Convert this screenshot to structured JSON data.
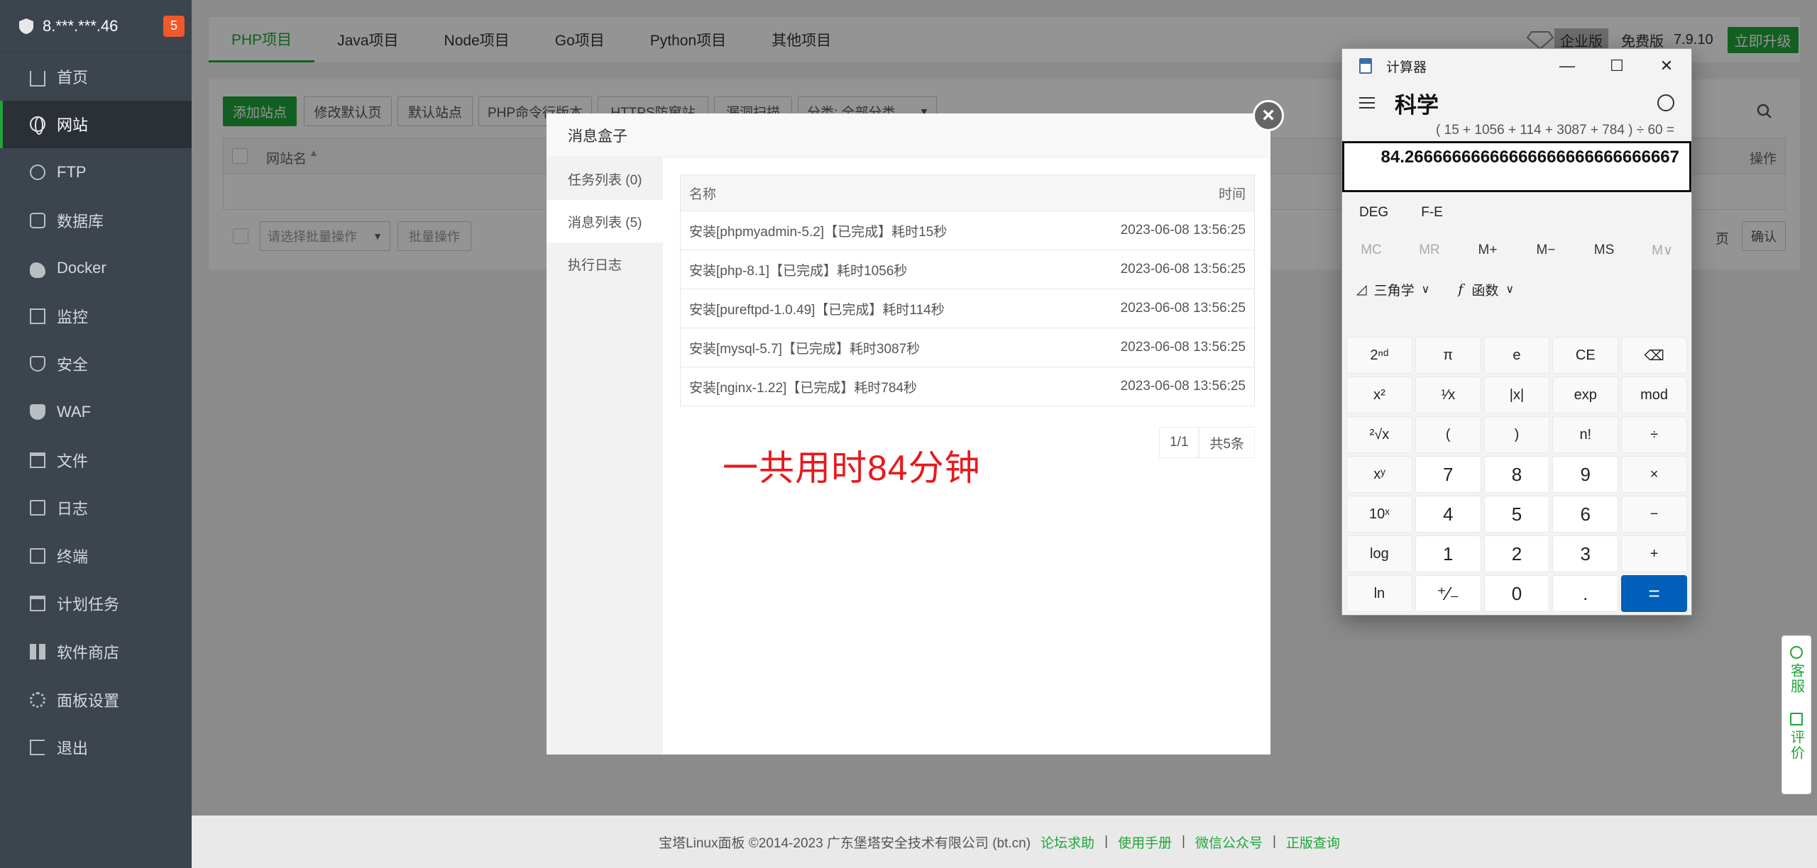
{
  "sidebar": {
    "server": "8.***.***.46",
    "badge": "5",
    "items": [
      {
        "label": "首页",
        "icon": "home-icon"
      },
      {
        "label": "网站",
        "icon": "globe-icon"
      },
      {
        "label": "FTP",
        "icon": "ftp-icon"
      },
      {
        "label": "数据库",
        "icon": "database-icon"
      },
      {
        "label": "Docker",
        "icon": "docker-icon"
      },
      {
        "label": "监控",
        "icon": "monitor-icon"
      },
      {
        "label": "安全",
        "icon": "shield-icon"
      },
      {
        "label": "WAF",
        "icon": "waf-icon"
      },
      {
        "label": "文件",
        "icon": "folder-icon"
      },
      {
        "label": "日志",
        "icon": "log-icon"
      },
      {
        "label": "终端",
        "icon": "terminal-icon"
      },
      {
        "label": "计划任务",
        "icon": "calendar-icon"
      },
      {
        "label": "软件商店",
        "icon": "store-icon"
      },
      {
        "label": "面板设置",
        "icon": "gear-icon"
      },
      {
        "label": "退出",
        "icon": "logout-icon"
      }
    ]
  },
  "tabs": [
    "PHP项目",
    "Java项目",
    "Node项目",
    "Go项目",
    "Python项目",
    "其他项目"
  ],
  "edition": {
    "enterprise": "企业版",
    "free": "免费版",
    "version": "7.9.10",
    "upgrade": "立即升级"
  },
  "toolbar": {
    "add_site": "添加站点",
    "edit_default": "修改默认页",
    "default_site": "默认站点",
    "php_cli": "PHP命令行版本",
    "https": "HTTPS防窜站",
    "scan": "漏洞扫描",
    "category": "分类: 全部分类"
  },
  "table": {
    "col_name": "网站名",
    "col_ops": "操作"
  },
  "batch": {
    "placeholder": "请选择批量操作",
    "button": "批量操作"
  },
  "pager_right": {
    "page": "页",
    "confirm": "确认"
  },
  "modal": {
    "title": "消息盒子",
    "tabs": [
      "任务列表 (0)",
      "消息列表 (5)",
      "执行日志"
    ],
    "col_name": "名称",
    "col_time": "时间",
    "rows": [
      {
        "name": "安装[phpmyadmin-5.2]【已完成】耗时15秒",
        "time": "2023-06-08 13:56:25"
      },
      {
        "name": "安装[php-8.1]【已完成】耗时1056秒",
        "time": "2023-06-08 13:56:25"
      },
      {
        "name": "安装[pureftpd-1.0.49]【已完成】耗时114秒",
        "time": "2023-06-08 13:56:25"
      },
      {
        "name": "安装[mysql-5.7]【已完成】耗时3087秒",
        "time": "2023-06-08 13:56:25"
      },
      {
        "name": "安装[nginx-1.22]【已完成】耗时784秒",
        "time": "2023-06-08 13:56:25"
      }
    ],
    "pager_page": "1/1",
    "pager_total": "共5条",
    "annotation": "一共用时84分钟"
  },
  "calculator": {
    "title": "计算器",
    "mode": "科学",
    "expression": "( 15 + 1056 + 114 + 3087 + 784 ) ÷ 60 =",
    "display": "84.26666666666666666666666666667",
    "deg": "DEG",
    "fe": "F-E",
    "memory": [
      "MC",
      "MR",
      "M+",
      "M−",
      "MS",
      "M∨"
    ],
    "trig": "三角学",
    "func": "函数",
    "keys": [
      "2ⁿᵈ",
      "π",
      "e",
      "CE",
      "⌫",
      "x²",
      "¹⁄x",
      "|x|",
      "exp",
      "mod",
      "²√x",
      "(",
      ")",
      "n!",
      "÷",
      "xʸ",
      "7",
      "8",
      "9",
      "×",
      "10ˣ",
      "4",
      "5",
      "6",
      "−",
      "log",
      "1",
      "2",
      "3",
      "+",
      "ln",
      "⁺⁄₋",
      "0",
      ".",
      "="
    ]
  },
  "float": {
    "service": "客服",
    "review": "评价"
  },
  "footer": {
    "copyright": "宝塔Linux面板 ©2014-2023 广东堡塔安全技术有限公司 (bt.cn)",
    "links": [
      "论坛求助",
      "使用手册",
      "微信公众号",
      "正版查询"
    ]
  }
}
